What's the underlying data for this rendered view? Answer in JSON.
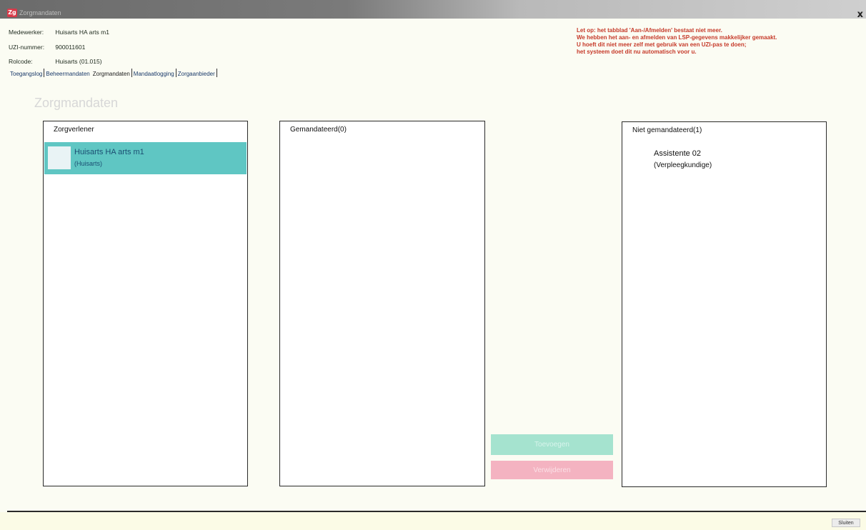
{
  "window": {
    "app_icon": "Zg",
    "title": "Zorgmandaten",
    "close_glyph": "x"
  },
  "header": {
    "medewerker_label": "Medewerker:",
    "medewerker_value": "Huisarts HA arts m1",
    "uzi_label": "UZI-nummer:",
    "uzi_value": "900011601",
    "rolcode_label": "Rolcode:",
    "rolcode_value": "Huisarts (01.015)"
  },
  "notice": {
    "line1": "Let op: het tabblad 'Aan-/Afmelden' bestaat niet meer.",
    "line2": "We hebben het aan- en afmelden van LSP-gegevens makkelijker gemaakt.",
    "line3": "U hoeft dit niet meer zelf met gebruik van een UZI-pas te doen;",
    "line4": "het systeem doet dit nu automatisch voor u."
  },
  "tabs": [
    {
      "label": "Toegangslog"
    },
    {
      "label": "Beheermandaten"
    },
    {
      "label": "Zorgmandaten"
    },
    {
      "label": "Mandaatlogging"
    },
    {
      "label": "Zorgaanbieder"
    }
  ],
  "page": {
    "title": "Zorgmandaten"
  },
  "panels": {
    "zorgverlener": {
      "header": "Zorgverlener",
      "items": [
        {
          "name": "Huisarts HA arts m1",
          "role": "(Huisarts)"
        }
      ]
    },
    "gemandateerd": {
      "header": "Gemandateerd(0)"
    },
    "niet_gemandateerd": {
      "header": "Niet gemandateerd(1)",
      "items": [
        {
          "name": "Assistente 02",
          "role": "(Verpleegkundige)"
        }
      ]
    }
  },
  "actions": {
    "add_label": "Toevoegen",
    "remove_label": "Verwijderen"
  },
  "footer": {
    "close_label": "Sluiten"
  },
  "colors": {
    "selected_row": "#5fc6c3",
    "add_button": "#a5e3cf",
    "remove_button": "#f4b3c1",
    "notice_text": "#c63a2a"
  }
}
